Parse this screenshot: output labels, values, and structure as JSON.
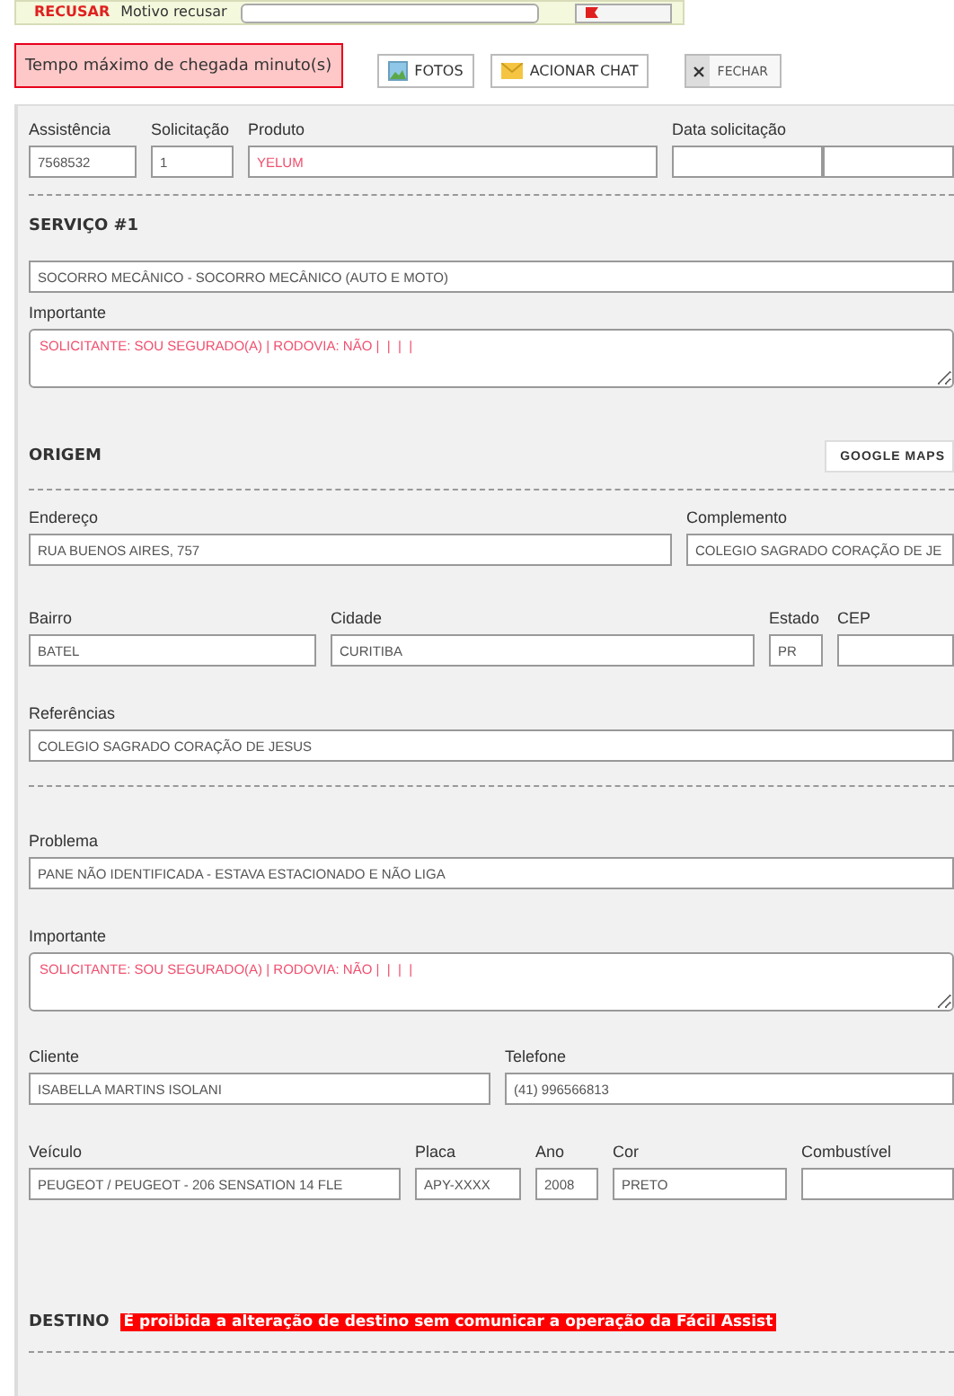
{
  "top_bar": {
    "refuse_label": "RECUSAR",
    "reason_label": "Motivo recusar"
  },
  "alert": "Tempo máximo de chegada minuto(s)",
  "actions": [
    {
      "label": "FOTOS",
      "kind": "photos"
    },
    {
      "label": "ACIONAR CHAT",
      "kind": "chat"
    },
    {
      "label": "FECHAR",
      "kind": "close"
    }
  ],
  "request_fields": [
    {
      "label": "Assistência",
      "value": "7568532",
      "highlight": false
    },
    {
      "label": "Solicitação",
      "value": "1",
      "highlight": false
    },
    {
      "label": "Produto",
      "value": "YELUM",
      "highlight": true
    },
    {
      "label": "Data solicitação",
      "kind": "split"
    }
  ],
  "service": {
    "title": "SERVIÇO #1",
    "value": "SOCORRO MECÂNICO - SOCORRO MECÂNICO (AUTO E MOTO)",
    "notes_label": "Importante",
    "notes": "SOLICITANTE: SOU SEGURADO(A) | RODOVIA: NÃO |  |  |  |"
  },
  "origin": {
    "title": "ORIGEM",
    "map_button": "GOOGLE MAPS",
    "address_fields": [
      {
        "label": "Endereço",
        "value": "RUA BUENOS AIRES, 757"
      },
      {
        "label": "Complemento",
        "value": "COLEGIO SAGRADO CORAÇÃO DE JE"
      }
    ],
    "area_fields": [
      {
        "label": "Bairro",
        "value": "BATEL"
      },
      {
        "label": "Cidade",
        "value": "CURITIBA"
      },
      {
        "label": "Estado",
        "value": "PR"
      },
      {
        "label": "CEP"
      }
    ],
    "reference": {
      "label": "Referências",
      "value": "COLEGIO SAGRADO CORAÇÃO DE JESUS"
    }
  },
  "problem": {
    "label": "Problema",
    "value": "PANE NÃO IDENTIFICADA - ESTAVA ESTACIONADO E NÃO LIGA",
    "notes_label": "Importante",
    "notes": "SOLICITANTE: SOU SEGURADO(A) | RODOVIA: NÃO |  |  |  |"
  },
  "client_fields": [
    {
      "label": "Cliente",
      "value": "ISABELLA MARTINS ISOLANI"
    },
    {
      "label": "Telefone",
      "value": "(41) 996566813"
    }
  ],
  "vehicle_fields": [
    {
      "label": "Veículo",
      "value": "PEUGEOT / PEUGEOT - 206 SENSATION 14 FLE"
    },
    {
      "label": "Placa",
      "value": "APY-XXXX"
    },
    {
      "label": "Ano",
      "value": "2008"
    },
    {
      "label": "Cor",
      "value": "PRETO"
    },
    {
      "label": "Combustível"
    }
  ],
  "destination": {
    "title": "DESTINO",
    "warning": "É proibida a alteração de destino sem comunicar a operação da Fácil Assist"
  }
}
